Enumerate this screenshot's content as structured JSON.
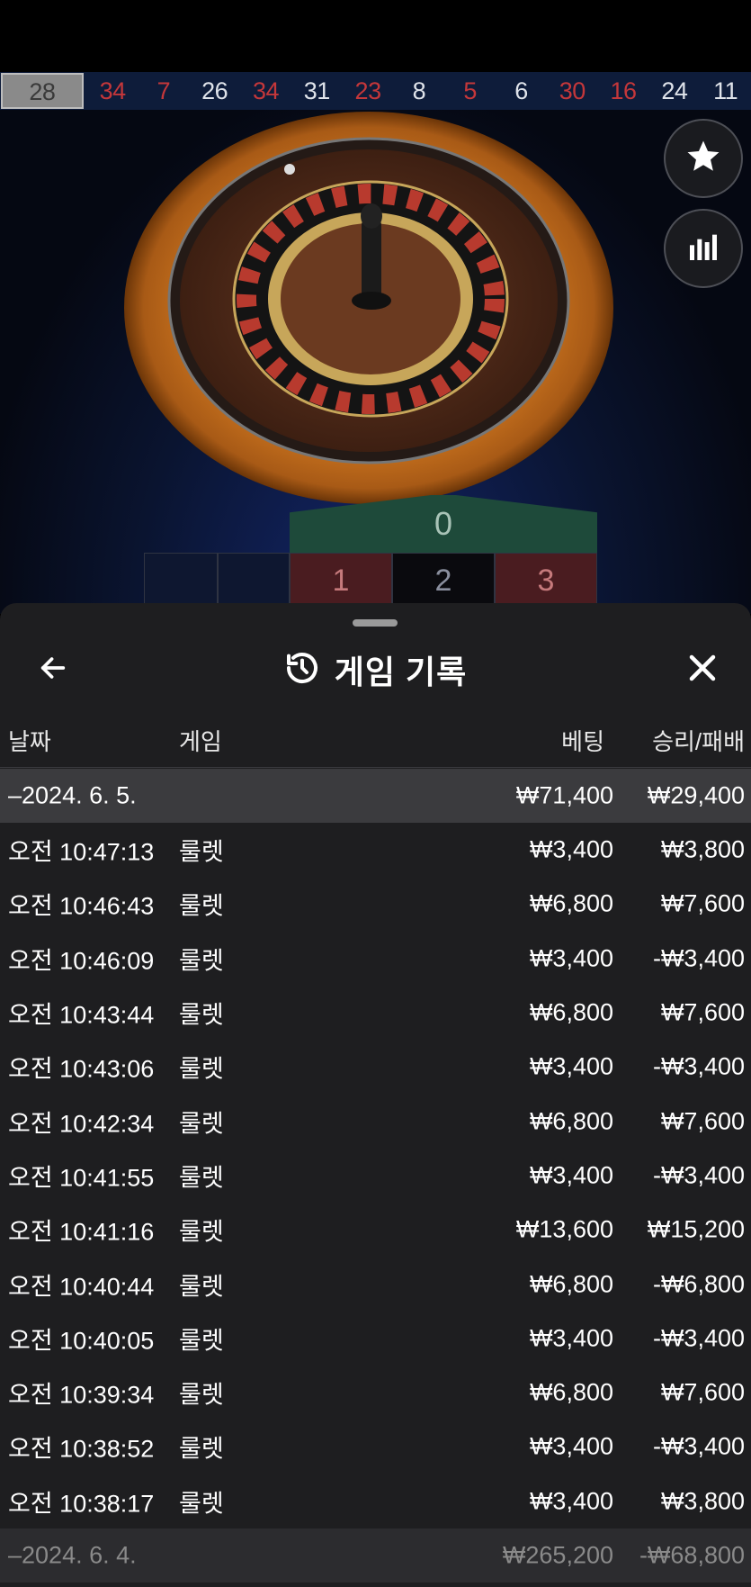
{
  "history": {
    "latest": "28",
    "numbers": [
      {
        "value": "34",
        "color": "red"
      },
      {
        "value": "7",
        "color": "red"
      },
      {
        "value": "26",
        "color": "black"
      },
      {
        "value": "34",
        "color": "red"
      },
      {
        "value": "31",
        "color": "black"
      },
      {
        "value": "23",
        "color": "red"
      },
      {
        "value": "8",
        "color": "black"
      },
      {
        "value": "5",
        "color": "red"
      },
      {
        "value": "6",
        "color": "black"
      },
      {
        "value": "30",
        "color": "red"
      },
      {
        "value": "16",
        "color": "red"
      },
      {
        "value": "24",
        "color": "black"
      },
      {
        "value": "11",
        "color": "black"
      }
    ]
  },
  "table": {
    "zero": "0",
    "cells": [
      "1",
      "2",
      "3"
    ]
  },
  "sheet": {
    "title": "게임 기록",
    "columns": {
      "date": "날짜",
      "game": "게임",
      "bet": "베팅",
      "win_loss": "승리/패배"
    },
    "groups": [
      {
        "date": "–2024. 6. 5.",
        "bet": "₩71,400",
        "win_loss": "₩29,400",
        "rows": [
          {
            "time": "오전 10:47:13",
            "game": "룰렛",
            "bet": "₩3,400",
            "win_loss": "₩3,800"
          },
          {
            "time": "오전 10:46:43",
            "game": "룰렛",
            "bet": "₩6,800",
            "win_loss": "₩7,600"
          },
          {
            "time": "오전 10:46:09",
            "game": "룰렛",
            "bet": "₩3,400",
            "win_loss": "-₩3,400"
          },
          {
            "time": "오전 10:43:44",
            "game": "룰렛",
            "bet": "₩6,800",
            "win_loss": "₩7,600"
          },
          {
            "time": "오전 10:43:06",
            "game": "룰렛",
            "bet": "₩3,400",
            "win_loss": "-₩3,400"
          },
          {
            "time": "오전 10:42:34",
            "game": "룰렛",
            "bet": "₩6,800",
            "win_loss": "₩7,600"
          },
          {
            "time": "오전 10:41:55",
            "game": "룰렛",
            "bet": "₩3,400",
            "win_loss": "-₩3,400"
          },
          {
            "time": "오전 10:41:16",
            "game": "룰렛",
            "bet": "₩13,600",
            "win_loss": "₩15,200"
          },
          {
            "time": "오전 10:40:44",
            "game": "룰렛",
            "bet": "₩6,800",
            "win_loss": "-₩6,800"
          },
          {
            "time": "오전 10:40:05",
            "game": "룰렛",
            "bet": "₩3,400",
            "win_loss": "-₩3,400"
          },
          {
            "time": "오전 10:39:34",
            "game": "룰렛",
            "bet": "₩6,800",
            "win_loss": "₩7,600"
          },
          {
            "time": "오전 10:38:52",
            "game": "룰렛",
            "bet": "₩3,400",
            "win_loss": "-₩3,400"
          },
          {
            "time": "오전 10:38:17",
            "game": "룰렛",
            "bet": "₩3,400",
            "win_loss": "₩3,800"
          }
        ]
      },
      {
        "date": "–2024. 6. 4.",
        "bet": "₩265,200",
        "win_loss": "-₩68,800",
        "rows": []
      }
    ]
  },
  "icons": {
    "favorite": "star-icon",
    "statistics": "bar-chart-icon",
    "back": "arrow-left-icon",
    "history": "history-icon",
    "close": "close-icon"
  }
}
